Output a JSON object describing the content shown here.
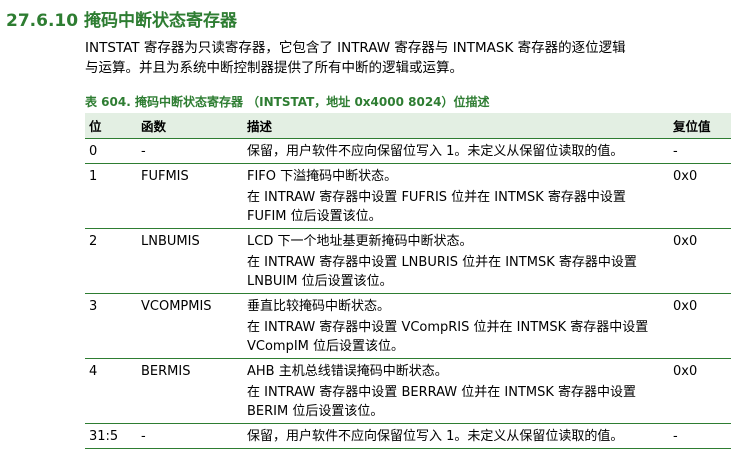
{
  "section": {
    "number": "27.6.10",
    "title": "掩码中断状态寄存器"
  },
  "intro": {
    "line1": "INTSTAT 寄存器为只读寄存器，它包含了 INTRAW 寄存器与 INTMASK 寄存器的逐位逻辑",
    "line2": "与运算。并且为系统中断控制器提供了所有中断的逻辑或运算。"
  },
  "table": {
    "caption": "表 604.   掩码中断状态寄存器 （INTSTAT，地址 0x4000 8024）位描述",
    "headers": {
      "bit": "位",
      "symbol": "函数",
      "description": "描述",
      "reset": "复位值"
    },
    "rows": [
      {
        "bit": "0",
        "symbol": "-",
        "desc1": "保留，用户软件不应向保留位写入 1。未定义从保留位读取的值。",
        "desc2": "",
        "reset": "-"
      },
      {
        "bit": "1",
        "symbol": "FUFMIS",
        "desc1": "FIFO 下溢掩码中断状态。",
        "desc2": "在 INTRAW 寄存器中设置 FUFRIS 位并在 INTMSK 寄存器中设置 FUFIM 位后设置该位。",
        "reset": "0x0"
      },
      {
        "bit": "2",
        "symbol": "LNBUMIS",
        "desc1": "LCD 下一个地址基更新掩码中断状态。",
        "desc2": "在 INTRAW 寄存器中设置 LNBURIS 位并在 INTMSK 寄存器中设置 LNBUIM 位后设置该位。",
        "reset": "0x0"
      },
      {
        "bit": "3",
        "symbol": "VCOMPMIS",
        "desc1": "垂直比较掩码中断状态。",
        "desc2": "在 INTRAW 寄存器中设置 VCompRIS 位并在 INTMSK 寄存器中设置 VCompIM 位后设置该位。",
        "reset": "0x0"
      },
      {
        "bit": "4",
        "symbol": "BERMIS",
        "desc1": "AHB 主机总线错误掩码中断状态。",
        "desc2": "在 INTRAW 寄存器中设置 BERRAW 位并在 INTMSK 寄存器中设置 BERIM 位后设置该位。",
        "reset": "0x0"
      },
      {
        "bit": "31:5",
        "symbol": "-",
        "desc1": "保留，用户软件不应向保留位写入 1。未定义从保留位读取的值。",
        "desc2": "",
        "reset": "-"
      }
    ]
  }
}
